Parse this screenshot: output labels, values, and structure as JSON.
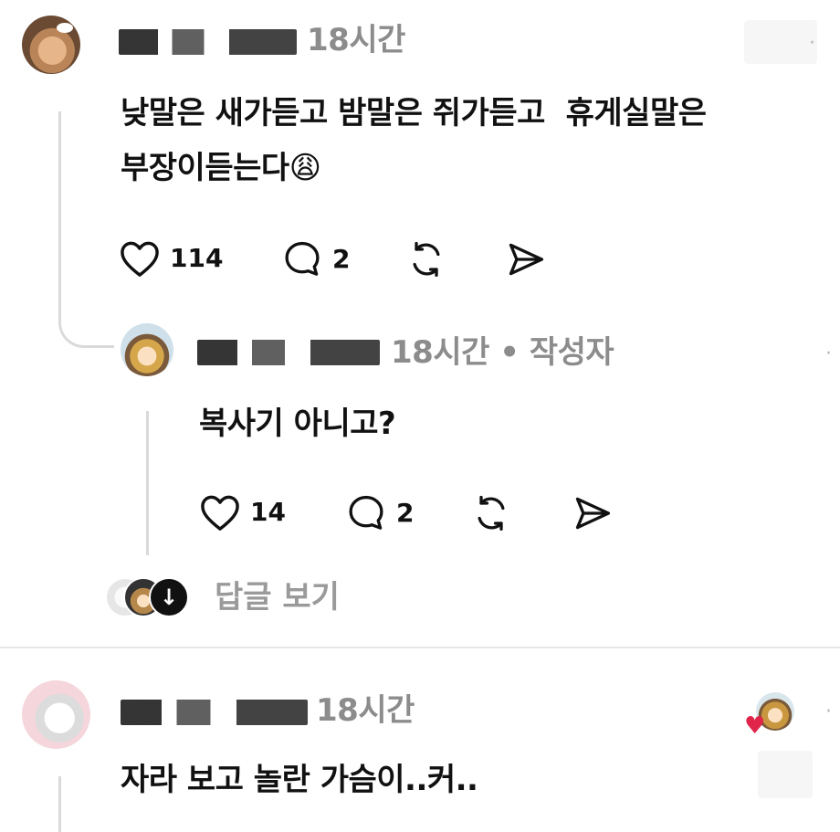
{
  "thread": {
    "comment1": {
      "time": "18시간",
      "text_line1": "낮말은 새가듣고 밤말은 쥐가듣고  휴게실말은",
      "text_line2": "부장이듣는다😩",
      "likes": "114",
      "replies": "2",
      "icons": [
        "heart-icon",
        "comment-icon",
        "repost-icon",
        "share-icon"
      ]
    },
    "reply1": {
      "time": "18시간",
      "author_tag": "• 작성자",
      "text": "복사기 아니고?",
      "likes": "14",
      "replies": "2"
    },
    "view_replies_label": "답글 보기",
    "comment2": {
      "time": "18시간",
      "text": "자라 보고 놀란 가슴이..커..",
      "liked_by_author": true
    },
    "more_glyph": "·"
  }
}
